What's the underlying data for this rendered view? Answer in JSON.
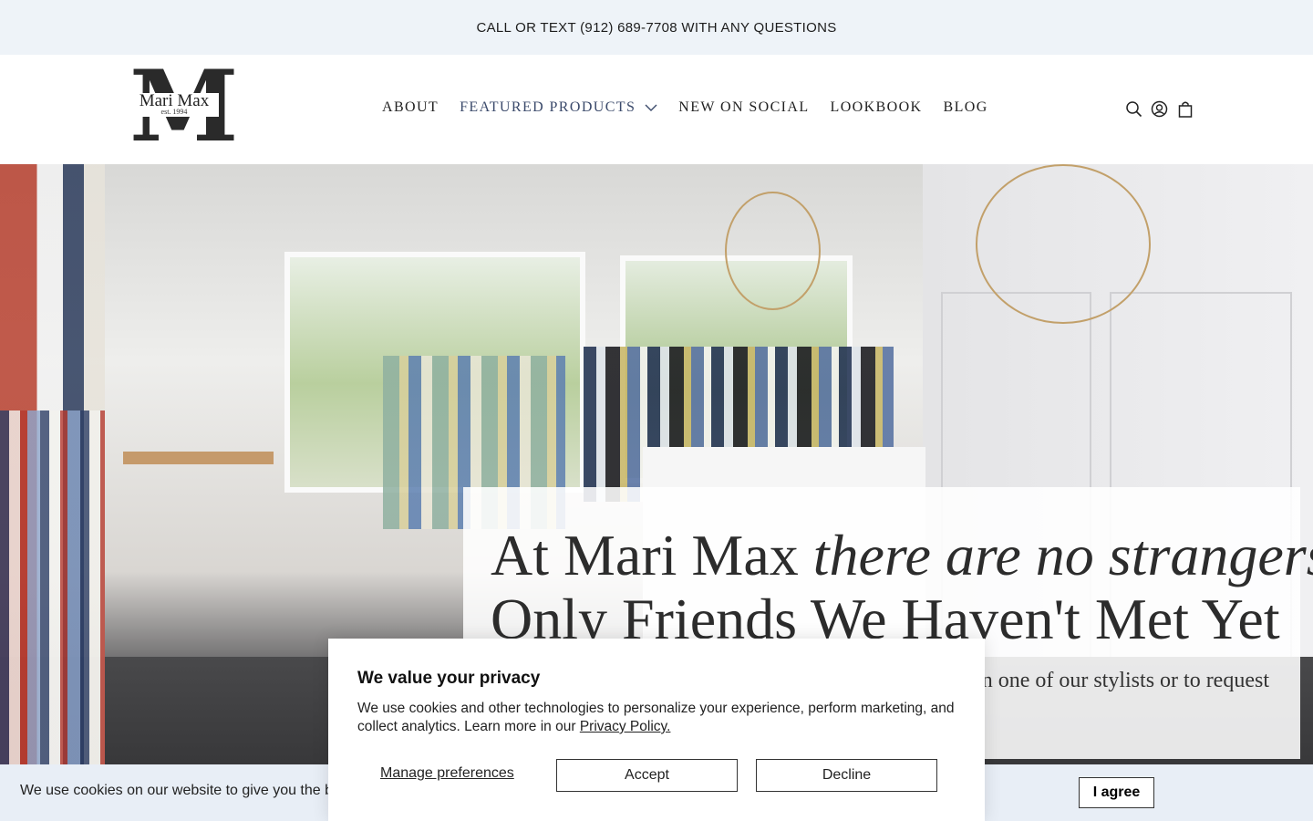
{
  "announcement": {
    "text": "CALL OR TEXT (912) 689-7708 WITH ANY QUESTIONS"
  },
  "header": {
    "logo": {
      "letter": "M",
      "brand": "Mari Max",
      "est": "est. 1994"
    },
    "nav": [
      {
        "label": "ABOUT"
      },
      {
        "label": "FEATURED PRODUCTS"
      },
      {
        "label": "NEW ON SOCIAL"
      },
      {
        "label": "LOOKBOOK"
      },
      {
        "label": "BLOG"
      }
    ],
    "icons": [
      "search-icon",
      "account-icon",
      "cart-icon"
    ]
  },
  "hero": {
    "line1_plain": "At Mari Max ",
    "line1_italic": "there are no strangers",
    "line2": "Only Friends We Haven't Met Yet",
    "subtext_visible": "n one of our stylists or to request"
  },
  "cookie_bar": {
    "text_visible": "We use cookies on our website to give you the b",
    "agree_label": "I agree"
  },
  "privacy_modal": {
    "title": "We value your privacy",
    "body": "We use cookies and other technologies to personalize your experience, perform marketing, and collect analytics. Learn more in our ",
    "policy_link": "Privacy Policy.",
    "manage_label": "Manage preferences",
    "accept_label": "Accept",
    "decline_label": "Decline"
  },
  "colors": {
    "announcement_bg": "#eef3f8",
    "featured_nav": "#3b4a6b",
    "cookie_bar_bg": "#e8eef6"
  }
}
